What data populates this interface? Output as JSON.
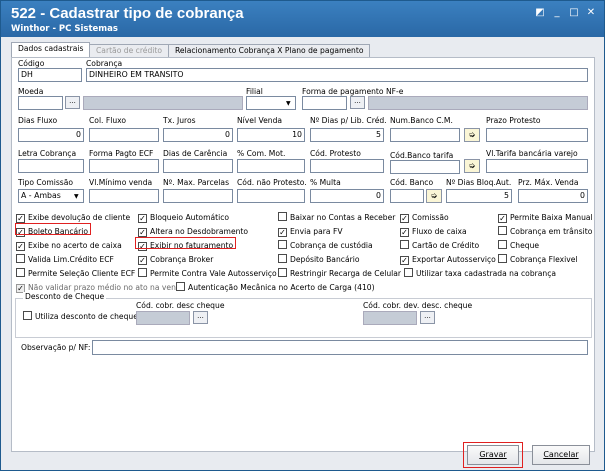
{
  "window": {
    "title": "522 - Cadastrar tipo de cobrança",
    "subtitle": "Winthor - PC Sistemas",
    "controls": [
      "◩",
      "_",
      "□",
      "✕"
    ]
  },
  "tabs": [
    {
      "label": "Dados cadastrais"
    },
    {
      "label": "Cartão de crédito"
    },
    {
      "label": "Relacionamento Cobrança X Plano de pagamento"
    }
  ],
  "fields": {
    "codigo": {
      "label": "Código",
      "value": "DH"
    },
    "cobranca": {
      "label": "Cobrança",
      "value": "DINHEIRO EM TRANSITO"
    },
    "moeda": {
      "label": "Moeda",
      "value": ""
    },
    "filial": {
      "label": "Filial",
      "value": ""
    },
    "forma_pag_nfe": {
      "label": "Forma de pagamento NF-e",
      "value": ""
    },
    "dias_fluxo": {
      "label": "Dias Fluxo",
      "value": "0"
    },
    "col_fluxo": {
      "label": "Col. Fluxo",
      "value": ""
    },
    "tx_juros": {
      "label": "Tx. Juros",
      "value": "0"
    },
    "nivel_venda": {
      "label": "Nível Venda",
      "value": "10"
    },
    "nr_dias_lib": {
      "label": "Nº Dias p/ Lib. Créd.",
      "value": "5"
    },
    "num_banco_cm": {
      "label": "Num.Banco C.M.",
      "value": ""
    },
    "prazo_protesto": {
      "label": "Prazo Protesto",
      "value": ""
    },
    "letra_cobranca": {
      "label": "Letra Cobrança",
      "value": ""
    },
    "forma_pagto_ecf": {
      "label": "Forma Pagto ECF",
      "value": ""
    },
    "dias_carencia": {
      "label": "Dias de Carência",
      "value": ""
    },
    "com_mot": {
      "label": "% Com. Mot.",
      "value": ""
    },
    "cod_protesto": {
      "label": "Cód. Protesto",
      "value": ""
    },
    "cod_banco_tarifa": {
      "label": "Cód.Banco tarifa",
      "value": ""
    },
    "vl_tarifa": {
      "label": "Vl.Tarifa bancária varejo",
      "value": ""
    },
    "tipo_comissao": {
      "label": "Tipo Comissão",
      "value": "A - Ambas"
    },
    "vl_minimo_venda": {
      "label": "Vl.Mínimo venda",
      "value": ""
    },
    "max_parcelas": {
      "label": "Nº. Max. Parcelas",
      "value": ""
    },
    "cod_nao_protesto": {
      "label": "Cód. não Protesto.",
      "value": ""
    },
    "multa": {
      "label": "% Multa",
      "value": "0"
    },
    "cod_banco": {
      "label": "Cód. Banco",
      "value": ""
    },
    "dias_bloq_aut": {
      "label": "Nº Dias Bloq.Aut.",
      "value": "5"
    },
    "prz_max_venda": {
      "label": "Prz. Máx. Venda",
      "value": "0"
    }
  },
  "checkboxes": [
    {
      "label": "Exibe devolução de cliente",
      "checked": true
    },
    {
      "label": "Bloqueio Automático",
      "checked": true
    },
    {
      "label": "Baixar no Contas a Receber",
      "checked": false
    },
    {
      "label": "Comissão",
      "checked": true
    },
    {
      "label": "Permite Baixa Manual",
      "checked": true
    },
    {
      "label": "Boleto Bancário",
      "checked": true
    },
    {
      "label": "Altera no Desdobramento",
      "checked": true
    },
    {
      "label": "Envia para FV",
      "checked": true
    },
    {
      "label": "Fluxo de caixa",
      "checked": true
    },
    {
      "label": "Cobrança em trânsito",
      "checked": false
    },
    {
      "label": "Exibe no acerto de caixa",
      "checked": true
    },
    {
      "label": "Exibir no faturamento",
      "checked": true
    },
    {
      "label": "Cobrança de custódia",
      "checked": false
    },
    {
      "label": "Cartão de Crédito",
      "checked": false
    },
    {
      "label": "Cheque",
      "checked": false
    },
    {
      "label": "Valida Lim.Crédito ECF",
      "checked": false
    },
    {
      "label": "Cobrança Broker",
      "checked": true
    },
    {
      "label": "Depósito Bancário",
      "checked": false
    },
    {
      "label": "Exportar Autosserviço",
      "checked": true
    },
    {
      "label": "Cobrança Flexivel",
      "checked": false
    },
    {
      "label": "Permite Seleção Cliente ECF",
      "checked": false
    },
    {
      "label": "Permite Contra Vale Autosserviço",
      "checked": false
    },
    {
      "label": "Restringir Recarga de Celular",
      "checked": false
    },
    {
      "label": "Utilizar taxa cadastrada na cobrança",
      "checked": false
    },
    {
      "label": "Não validar prazo médio no ato na venda",
      "checked": true
    },
    {
      "label": "Autenticação Mecânica no Acerto de Carga (410)",
      "checked": false
    }
  ],
  "desconto": {
    "title": "Desconto de Cheque",
    "utiliza": "Utiliza desconto de cheque",
    "cod_desc": "Cód. cobr. desc cheque",
    "cod_dev_desc": "Cód. cobr. dev. desc. cheque",
    "ellipsis": "..."
  },
  "obs": {
    "label": "Observação p/ NF:",
    "value": ""
  },
  "buttons": {
    "gravar": "Gravar",
    "cancelar": "Cancelar"
  },
  "highlight_color": "#e02020"
}
